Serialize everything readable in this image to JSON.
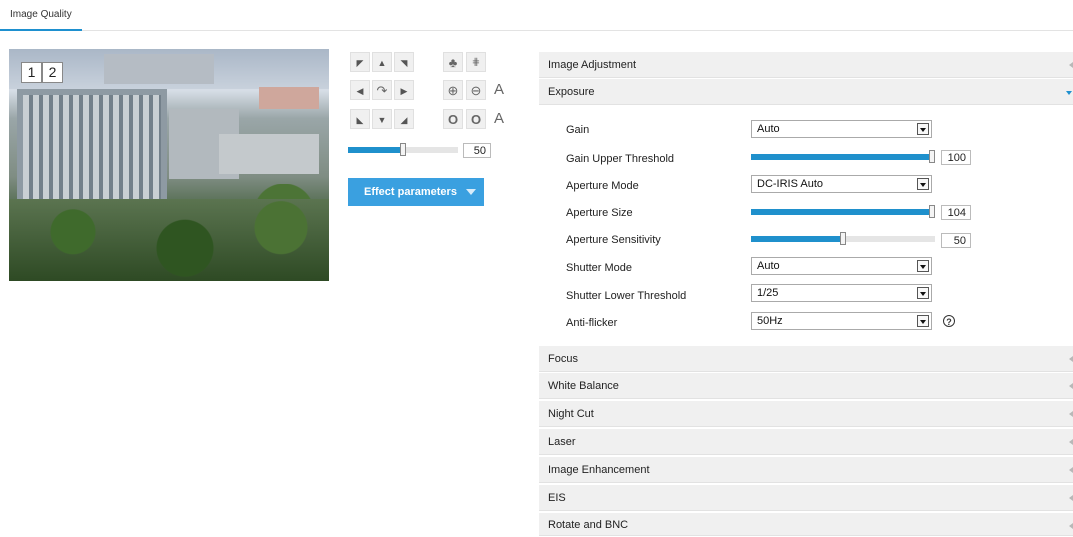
{
  "tabs": [
    {
      "label": "Image Quality",
      "active": true
    }
  ],
  "preview": {
    "channels": [
      "1",
      "2"
    ]
  },
  "ptz": {
    "zoom_in_glyph": "⊕",
    "zoom_out_glyph": "⊖",
    "auto_glyph": "A",
    "iris_open_glyph": "O",
    "iris_close_glyph": "O",
    "speed_value": "50",
    "speed_fraction": 0.5,
    "effect_button_label": "Effect parameters"
  },
  "sections_top": [
    {
      "label": "Image Adjustment",
      "expanded": false
    },
    {
      "label": "Exposure",
      "expanded": true
    }
  ],
  "exposure": {
    "gain": {
      "label": "Gain",
      "value": "Auto"
    },
    "gain_upper": {
      "label": "Gain Upper Threshold",
      "value": "100",
      "fraction": 1.0
    },
    "aperture_mode": {
      "label": "Aperture Mode",
      "value": "DC-IRIS Auto"
    },
    "aperture_size": {
      "label": "Aperture Size",
      "value": "104",
      "fraction": 1.0
    },
    "aperture_sensitivity": {
      "label": "Aperture Sensitivity",
      "value": "50",
      "fraction": 0.5
    },
    "shutter_mode": {
      "label": "Shutter Mode",
      "value": "Auto"
    },
    "shutter_lower": {
      "label": "Shutter Lower Threshold",
      "value": "1/25"
    },
    "anti_flicker": {
      "label": "Anti-flicker",
      "value": "50Hz"
    },
    "help_glyph": "?"
  },
  "sections_bottom": [
    {
      "label": "Focus"
    },
    {
      "label": "White Balance"
    },
    {
      "label": "Night Cut"
    },
    {
      "label": "Laser"
    },
    {
      "label": "Image Enhancement"
    },
    {
      "label": "EIS"
    },
    {
      "label": "Rotate and BNC"
    }
  ],
  "colors": {
    "accent": "#1f90cc",
    "button": "#3aa0e0",
    "section_bg": "#f0f0f0"
  }
}
